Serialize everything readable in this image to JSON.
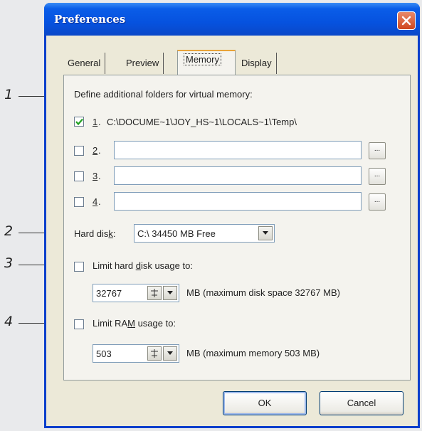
{
  "window": {
    "title": "Preferences"
  },
  "tabs": [
    {
      "label": "General"
    },
    {
      "label": "Preview"
    },
    {
      "label": "Memory",
      "active": true
    },
    {
      "label": "Display"
    }
  ],
  "callouts": [
    "1",
    "2",
    "3",
    "4"
  ],
  "memory": {
    "folders_heading": "Define additional folders for virtual memory:",
    "folders": [
      {
        "number": "1",
        "checked": true,
        "path": "C:\\DOCUME~1\\JOY_HS~1\\LOCALS~1\\Temp\\"
      },
      {
        "number": "2",
        "checked": false,
        "path": "",
        "browse_label": "..."
      },
      {
        "number": "3",
        "checked": false,
        "path": "",
        "browse_label": "..."
      },
      {
        "number": "4",
        "checked": false,
        "path": "",
        "browse_label": "..."
      }
    ],
    "hard_disk_label_pre": "Hard dis",
    "hard_disk_label_ul": "k",
    "hard_disk_label_post": ":",
    "hard_disk_value": "C:\\ 34450 MB Free",
    "limit_disk": {
      "checked": false,
      "label_pre": "Limit hard ",
      "label_ul": "d",
      "label_post": "isk usage to:",
      "value": "32767",
      "note": "MB (maximum disk space 32767 MB)"
    },
    "limit_ram": {
      "checked": false,
      "label_pre": "Limit RA",
      "label_ul": "M",
      "label_post": " usage to:",
      "value": "503",
      "note": "MB (maximum memory 503 MB)"
    }
  },
  "buttons": {
    "ok": "OK",
    "cancel": "Cancel"
  },
  "colors": {
    "titlebar": "#0652df",
    "window_face": "#ece9d8",
    "close_button": "#d0461d",
    "active_tab_accent": "#e8a33a"
  },
  "icons": {
    "close": "close-icon",
    "check": "checkmark-icon",
    "dropdown": "chevron-down-icon",
    "spin": "spin-updown-icon"
  }
}
